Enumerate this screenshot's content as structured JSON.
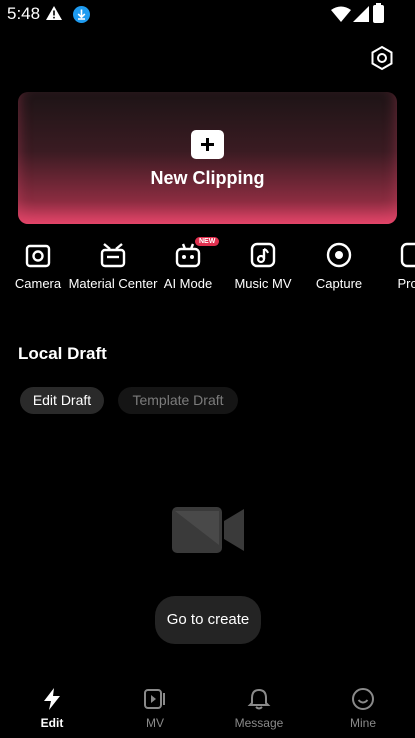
{
  "status_bar": {
    "time": "5:48",
    "icons": [
      "warning-icon",
      "download-icon",
      "wifi-icon",
      "signal-icon",
      "battery-icon"
    ]
  },
  "header": {
    "settings_icon": "settings-hexagon-icon"
  },
  "new_clip": {
    "label": "New Clipping",
    "icon": "plus-icon"
  },
  "features": [
    {
      "label": "Camera",
      "icon": "camera-icon"
    },
    {
      "label": "Material Center",
      "icon": "material-center-icon"
    },
    {
      "label": "AI Mode",
      "icon": "ai-robot-icon",
      "badge": "NEW"
    },
    {
      "label": "Music MV",
      "icon": "music-note-icon"
    },
    {
      "label": "Capture",
      "icon": "capture-icon"
    },
    {
      "label": "Prom",
      "icon": "prom-icon"
    }
  ],
  "local_draft": {
    "title": "Local Draft",
    "tabs": [
      {
        "label": "Edit Draft",
        "active": true
      },
      {
        "label": "Template Draft",
        "active": false
      }
    ],
    "empty_icon": "video-camera-icon",
    "create_label": "Go to create"
  },
  "bottom_nav": [
    {
      "label": "Edit",
      "icon": "lightning-icon",
      "active": true
    },
    {
      "label": "MV",
      "icon": "mv-play-icon",
      "active": false
    },
    {
      "label": "Message",
      "icon": "bell-icon",
      "active": false
    },
    {
      "label": "Mine",
      "icon": "smiley-icon",
      "active": false
    }
  ],
  "colors": {
    "accent": "#e0304f",
    "download": "#1e9bf0",
    "background": "#000000"
  }
}
